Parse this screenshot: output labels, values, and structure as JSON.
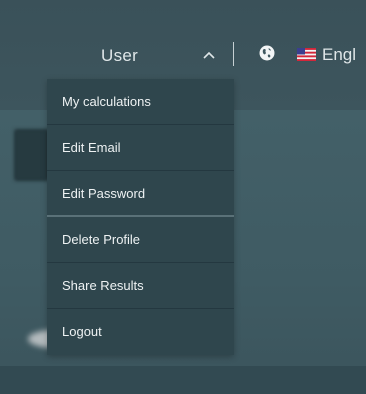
{
  "header": {
    "user_label": "User",
    "language_label": "Engl",
    "globe_icon": "globe-icon",
    "flag_icon": "us-flag-icon",
    "caret_icon": "chevron-up-icon"
  },
  "user_menu": {
    "items": [
      {
        "label": "My calculations"
      },
      {
        "label": "Edit Email"
      },
      {
        "label": "Edit Password"
      },
      {
        "label": "Delete Profile"
      },
      {
        "label": "Share Results"
      },
      {
        "label": "Logout"
      }
    ]
  },
  "colors": {
    "background": "#3f5860",
    "menu_background": "#2f464d",
    "text": "#eef2f3"
  }
}
